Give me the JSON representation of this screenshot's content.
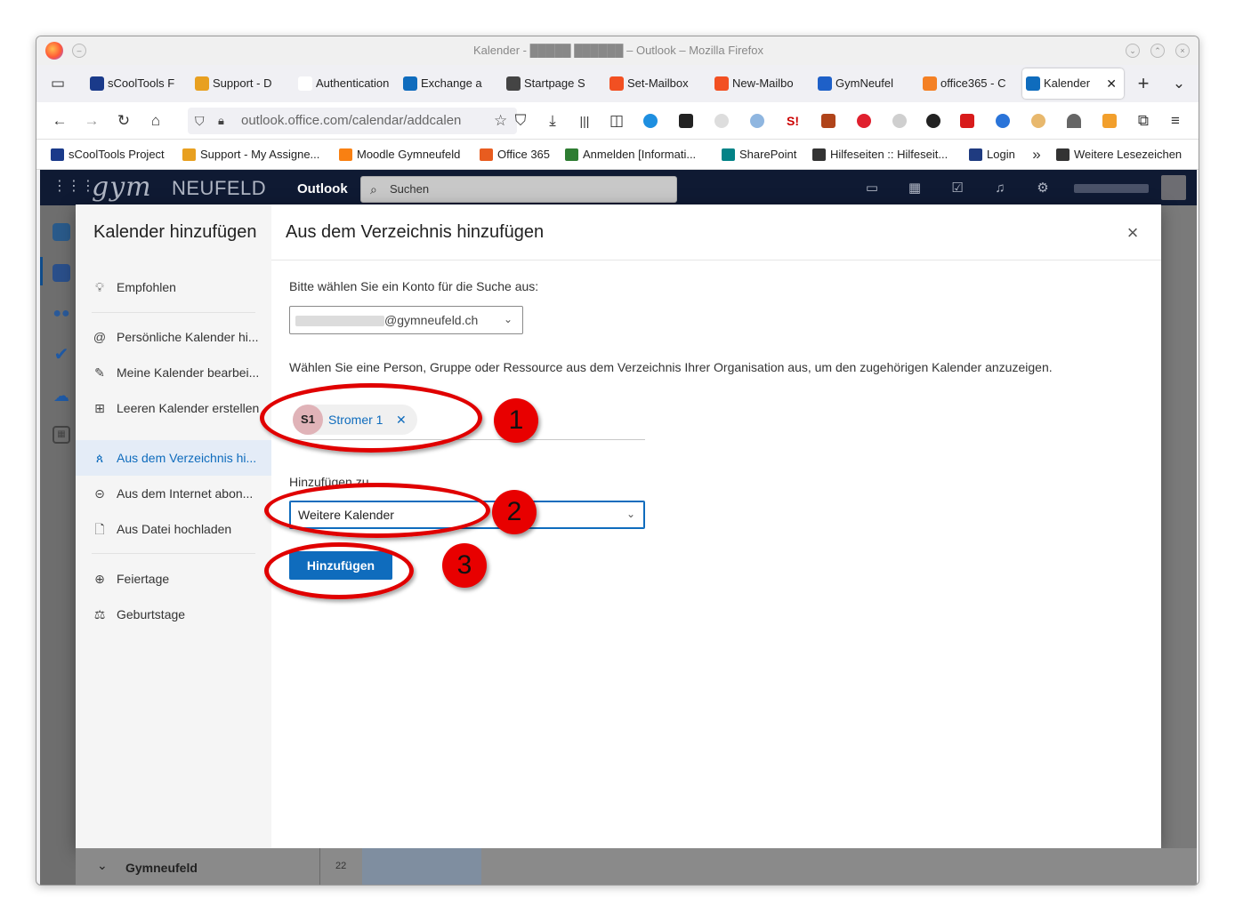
{
  "browser": {
    "window_title": "Kalender - █████ ██████ – Outlook – Mozilla Firefox",
    "tabs": [
      {
        "label": "sCoolTools F",
        "color": "#1a3a8a"
      },
      {
        "label": "Support - D",
        "color": "#e8a020"
      },
      {
        "label": "Authentication",
        "color": "#ffffff"
      },
      {
        "label": "Exchange a",
        "color": "#0f6cbd"
      },
      {
        "label": "Startpage S",
        "color": "#444444"
      },
      {
        "label": "Set-Mailbox",
        "color": "#f25022"
      },
      {
        "label": "New-Mailbo",
        "color": "#f25022"
      },
      {
        "label": "GymNeufel",
        "color": "#1e60c8"
      },
      {
        "label": "office365 - C",
        "color": "#f48024"
      },
      {
        "label": "Kalender",
        "color": "#0f6cbd"
      }
    ],
    "url": "outlook.office.com/calendar/addcalen",
    "bookmarks": [
      {
        "label": "sCoolTools Project",
        "color": "#1a3a8a"
      },
      {
        "label": "Support - My Assigne...",
        "color": "#e8a020"
      },
      {
        "label": "Moodle Gymneufeld",
        "color": "#f98012"
      },
      {
        "label": "Office 365",
        "color": "#e85c1f"
      },
      {
        "label": "Anmelden [Informati...",
        "color": "#2e7d32"
      },
      {
        "label": "SharePoint",
        "color": "#038387"
      },
      {
        "label": "Hilfeseiten :: Hilfeseit...",
        "color": "#333333"
      },
      {
        "label": "Login",
        "color": "#1f3b80"
      },
      {
        "label": "Weitere Lesezeichen",
        "color": "#333333"
      }
    ]
  },
  "outlook": {
    "logo_gym": "gym",
    "logo_neufeld": "NEUFELD",
    "app_name": "Outlook",
    "search_placeholder": "Suchen"
  },
  "dialog": {
    "left_title": "Kalender hinzufügen",
    "nav": [
      {
        "label": "Empfohlen",
        "icon": "lightbulb-icon"
      },
      {
        "label": "Persönliche Kalender hi...",
        "icon": "at-icon"
      },
      {
        "label": "Meine Kalender bearbei...",
        "icon": "edit-calendar-icon"
      },
      {
        "label": "Leeren Kalender erstellen",
        "icon": "calendar-add-icon"
      },
      {
        "label": "Aus dem Verzeichnis hi...",
        "icon": "people-icon"
      },
      {
        "label": "Aus dem Internet abon...",
        "icon": "link-icon"
      },
      {
        "label": "Aus Datei hochladen",
        "icon": "file-icon"
      },
      {
        "label": "Feiertage",
        "icon": "globe-icon"
      },
      {
        "label": "Geburtstage",
        "icon": "cake-icon"
      }
    ],
    "selected_nav": "Aus dem Verzeichnis hi...",
    "right_title": "Aus dem Verzeichnis hinzufügen",
    "account_prompt": "Bitte wählen Sie ein Konto für die Suche aus:",
    "account_value": "@gymneufeld.ch",
    "directory_prompt": "Wählen Sie eine Person, Gruppe oder Ressource aus dem Verzeichnis Ihrer Organisation aus, um den zugehörigen Kalender anzuzeigen.",
    "person_initials": "S1",
    "person_name": "Stromer 1",
    "add_to_label": "Hinzufügen zu",
    "add_to_value": "Weitere Kalender",
    "add_button": "Hinzufügen"
  },
  "annotations": [
    "1",
    "2",
    "3"
  ],
  "background": {
    "folder": "Gymneufeld",
    "row_number": "22"
  }
}
